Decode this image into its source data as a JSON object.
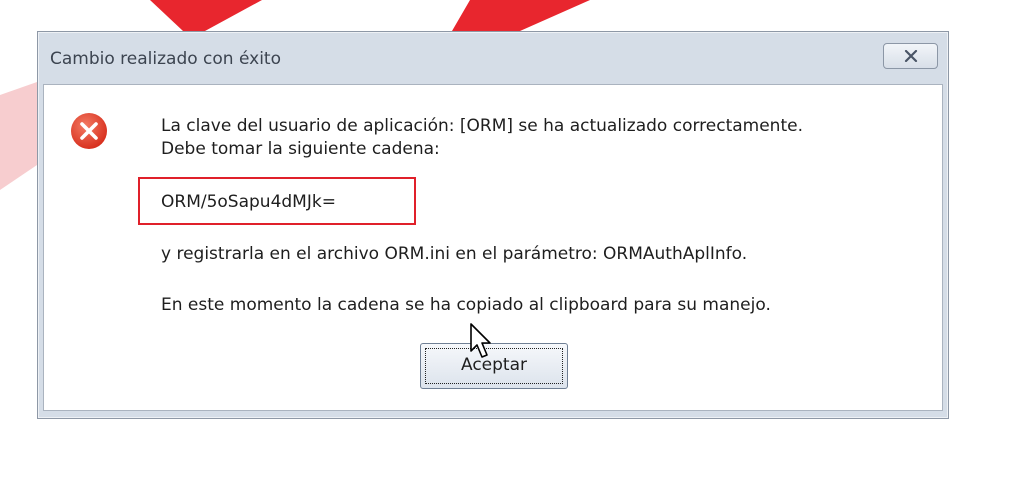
{
  "dialog": {
    "title": "Cambio realizado con éxito",
    "close_symbol": "✕",
    "icon": "error-icon",
    "message_line1": "La clave del usuario de aplicación: [ORM] se ha actualizado correctamente.",
    "message_line2": "Debe tomar la siguiente cadena:",
    "token": "ORM/5oSapu4dMJk=",
    "message_line3": "y registrarla en el archivo ORM.ini en el parámetro: ORMAuthAplInfo.",
    "message_line4": "En este momento la cadena se ha copiado al clipboard para su manejo.",
    "ok_label": "Aceptar"
  },
  "colors": {
    "highlight_border": "#e0202a",
    "error_icon": "#e8442e",
    "background_swoosh": "#e8262e"
  }
}
